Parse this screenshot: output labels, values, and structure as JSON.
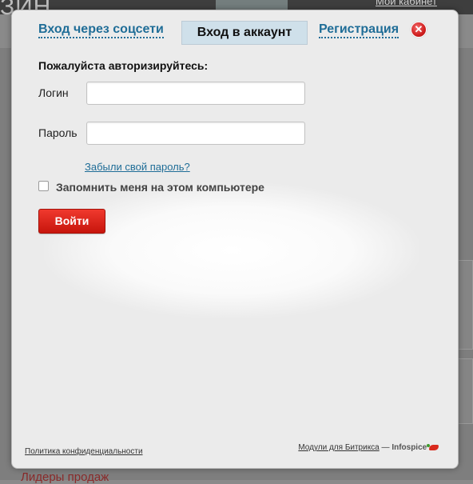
{
  "background": {
    "logo_fragment": "ЗИН",
    "cabinet_link": "Мой кабинет",
    "leaders_title": "Лидеры продаж"
  },
  "tabs": {
    "social": "Вход через соцсети",
    "account": "Вход в аккаунт",
    "register": "Регистрация"
  },
  "form": {
    "heading": "Пожалуйста авторизируйтесь:",
    "login_label": "Логин",
    "login_value": "",
    "password_label": "Пароль",
    "password_value": "",
    "forgot_link": "Забыли свой пароль?",
    "remember_label": "Запомнить меня на этом компьютере",
    "remember_checked": false,
    "submit_label": "Войти"
  },
  "footer": {
    "privacy_link": "Политика конфиденциальности",
    "modules_link": "Модули для Битрикса",
    "separator": " — ",
    "brand": "Infospice"
  },
  "colors": {
    "accent_link": "#1f6d97",
    "submit_button": "#d9231a",
    "active_tab": "#cfe0ea",
    "close_button": "#d01f1f"
  },
  "icons": [
    "close-icon",
    "chili-pepper-icon"
  ]
}
